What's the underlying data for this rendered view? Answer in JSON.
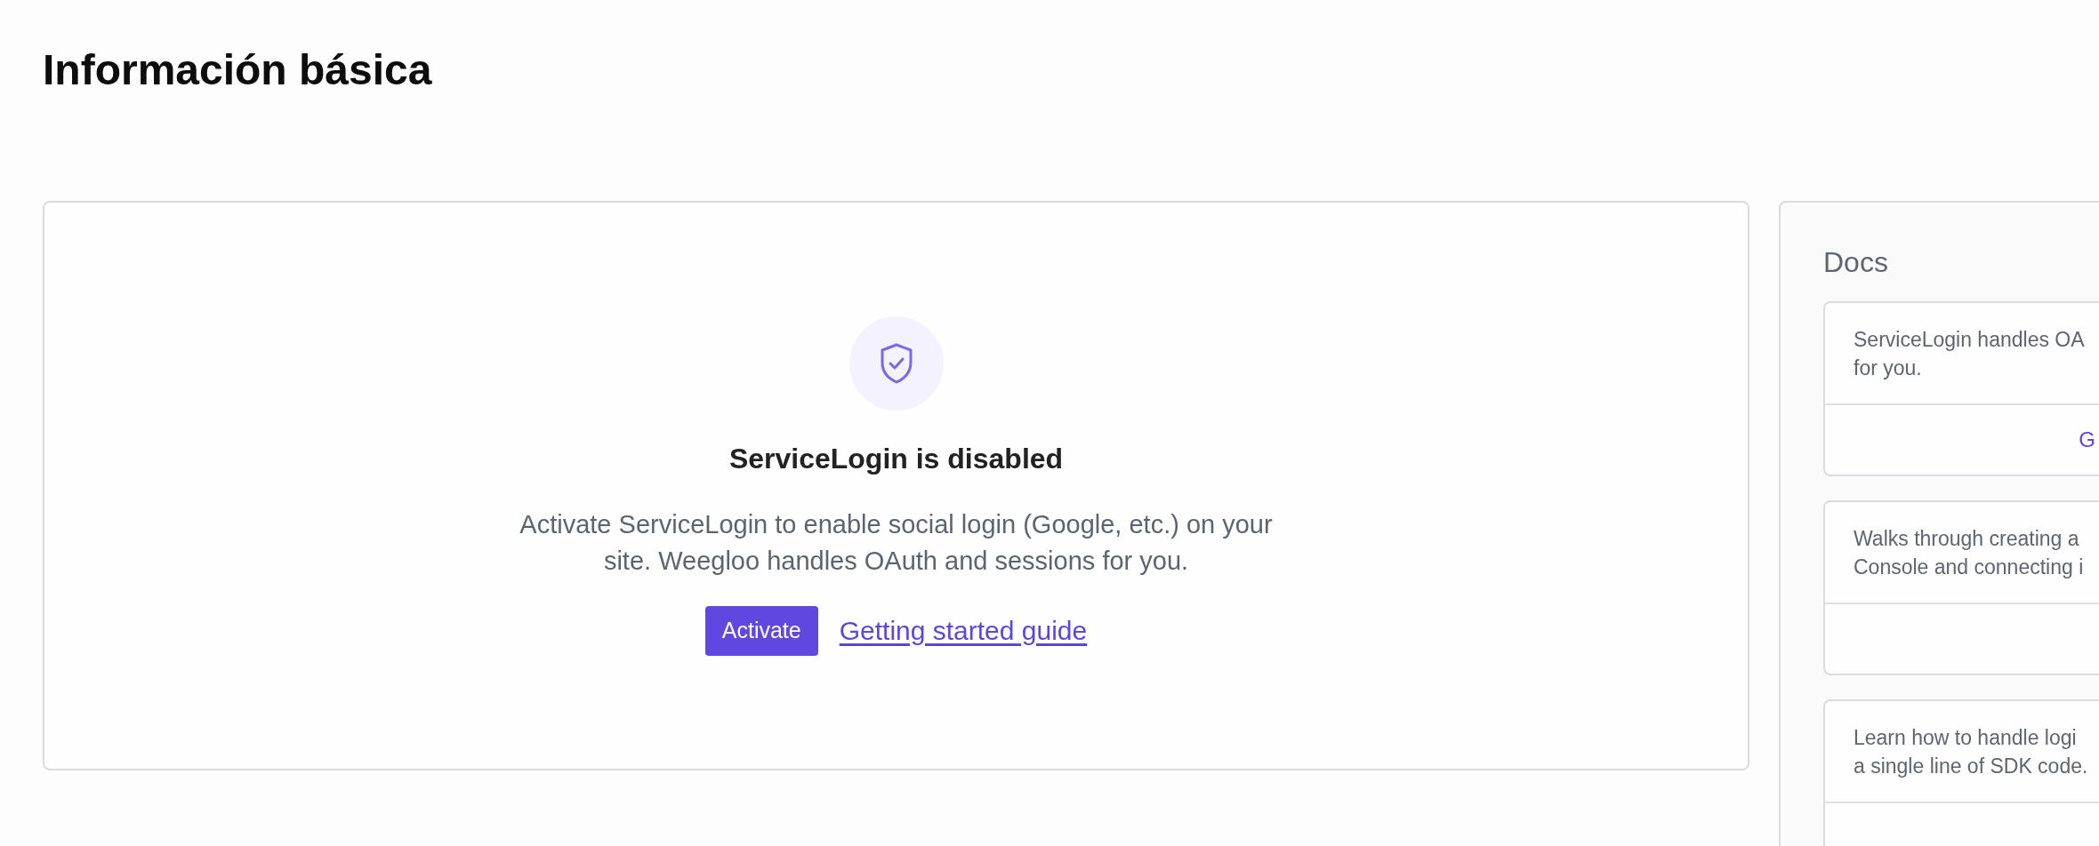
{
  "page": {
    "title": "Información básica"
  },
  "status_card": {
    "title": "ServiceLogin is disabled",
    "description": "Activate ServiceLogin to enable social login (Google, etc.) on your site. Weegloo handles OAuth and sessions for you.",
    "button": "Activate",
    "link": "Getting started guide"
  },
  "docs": {
    "title": "Docs",
    "items": [
      {
        "lines": [
          "ServiceLogin handles OA",
          "for you."
        ],
        "link": "G"
      },
      {
        "lines": [
          "Walks through creating a",
          "Console and connecting i"
        ]
      },
      {
        "lines": [
          "Learn how to handle logi",
          "a single line of SDK code."
        ]
      }
    ]
  }
}
